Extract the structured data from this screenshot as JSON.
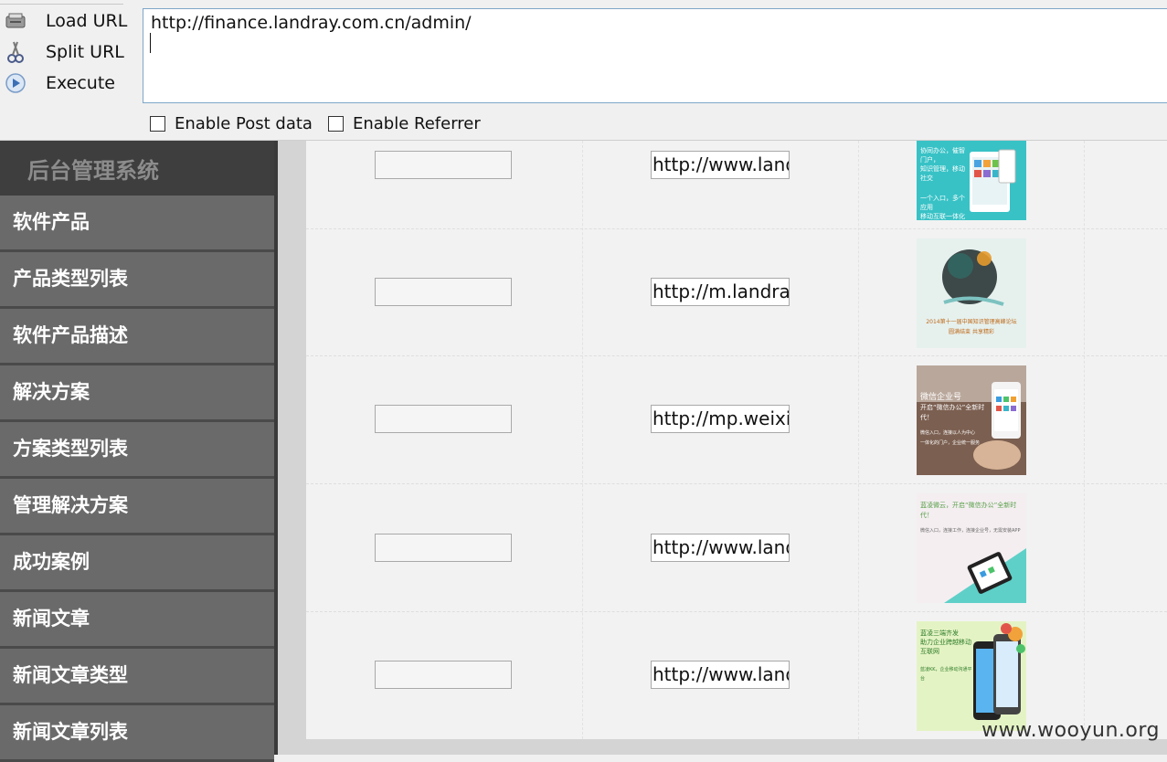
{
  "toolbar": {
    "load_url": "Load URL",
    "split_url": "Split URL",
    "execute": "Execute",
    "url_value": "http://finance.landray.com.cn/admin/",
    "enable_post": "Enable Post data",
    "enable_referrer": "Enable Referrer",
    "icons": [
      "load-url-icon",
      "split-url-icon",
      "execute-icon"
    ]
  },
  "sidebar": {
    "title": "后台管理系统",
    "items": [
      {
        "label": "软件产品"
      },
      {
        "label": "产品类型列表"
      },
      {
        "label": "软件产品描述"
      },
      {
        "label": "解决方案"
      },
      {
        "label": "方案类型列表"
      },
      {
        "label": "管理解决方案"
      },
      {
        "label": "成功案例"
      },
      {
        "label": "新闻文章"
      },
      {
        "label": "新闻文章类型"
      },
      {
        "label": "新闻文章列表"
      }
    ]
  },
  "table": {
    "rows": [
      {
        "input": "",
        "url": "http://www.landray",
        "thumb_text": [
          "协同办公，催智门户，",
          "知识管理，移动社交",
          "一个入口，多个应用",
          "移动互联一体化"
        ]
      },
      {
        "input": "",
        "url": "http://m.landray.c",
        "thumb_text": [
          "2014第十一届中国知识管理高峰论坛",
          "圆满结束  共享精彩"
        ]
      },
      {
        "input": "",
        "url": "http://mp.weixin.q",
        "thumb_text": [
          "微信企业号",
          "开启“微信办公”全新时代！",
          "微信入口，连接以人为中心",
          "一体化的门户，企业统一服务"
        ]
      },
      {
        "input": "",
        "url": "http://www.landray",
        "thumb_text": [
          "蓝凌微云，开启“微信办公”全新时代！",
          "微信入口，连接工作，连接企业号，无需安装APP"
        ]
      },
      {
        "input": "",
        "url": "http://www.landray",
        "thumb_text": [
          "蓝凌三端齐发",
          "助力企业跨越移动互联网",
          "蓝凌KK，企业移动沟通平台"
        ]
      }
    ]
  },
  "watermark": "www.wooyun.org"
}
